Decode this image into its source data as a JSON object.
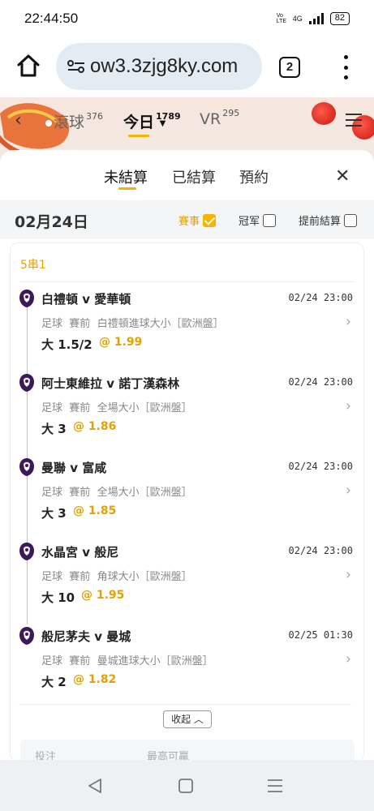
{
  "status_bar": {
    "time": "22:44:50",
    "network_small": "Vo LTE",
    "network": "4G",
    "battery": "82"
  },
  "browser": {
    "url": "ow3.3zjg8ky.com",
    "tab_count": "2"
  },
  "site_nav": {
    "tabs": [
      {
        "label": "滾球",
        "count": "376"
      },
      {
        "label": "今日",
        "count": "1789"
      },
      {
        "label": "VR",
        "count": "295"
      }
    ],
    "active_index": 1
  },
  "sheet": {
    "tabs": [
      "未結算",
      "已結算",
      "預約"
    ],
    "active_tab": "未結算",
    "close_symbol": "✕"
  },
  "date_row": {
    "date": "02月24日",
    "filters": [
      {
        "label": "賽事",
        "checked": true
      },
      {
        "label": "冠军",
        "checked": false
      },
      {
        "label": "提前結算",
        "checked": false
      }
    ]
  },
  "bet_slip": {
    "combo_label": "5串1",
    "legs": [
      {
        "match": "白禮頓 v 愛華頓",
        "time": "02/24 23:00",
        "sport": "足球",
        "stage": "賽前",
        "market": "白禮頓進球大小［歐洲盤］",
        "pick": "大 1.5/2",
        "odds": "@ 1.99"
      },
      {
        "match": "阿士東維拉 v 諾丁漢森林",
        "time": "02/24 23:00",
        "sport": "足球",
        "stage": "賽前",
        "market": "全場大小［歐洲盤］",
        "pick": "大 3",
        "odds": "@ 1.86"
      },
      {
        "match": "曼聯 v 富咸",
        "time": "02/24 23:00",
        "sport": "足球",
        "stage": "賽前",
        "market": "全場大小［歐洲盤］",
        "pick": "大 3",
        "odds": "@ 1.85"
      },
      {
        "match": "水晶宮 v 般尼",
        "time": "02/24 23:00",
        "sport": "足球",
        "stage": "賽前",
        "market": "角球大小［歐洲盤］",
        "pick": "大 10",
        "odds": "@ 1.95"
      },
      {
        "match": "般尼茅夫 v 曼城",
        "time": "02/25 01:30",
        "sport": "足球",
        "stage": "賽前",
        "market": "曼城進球大小［歐洲盤］",
        "pick": "大 2",
        "odds": "@ 1.82"
      }
    ],
    "collapse_label": "收起",
    "summary_labels": [
      "投注",
      "最高可贏"
    ]
  },
  "colors": {
    "accent": "#f4b400",
    "odds": "#e6a100",
    "league_logo": "#3d195b"
  }
}
